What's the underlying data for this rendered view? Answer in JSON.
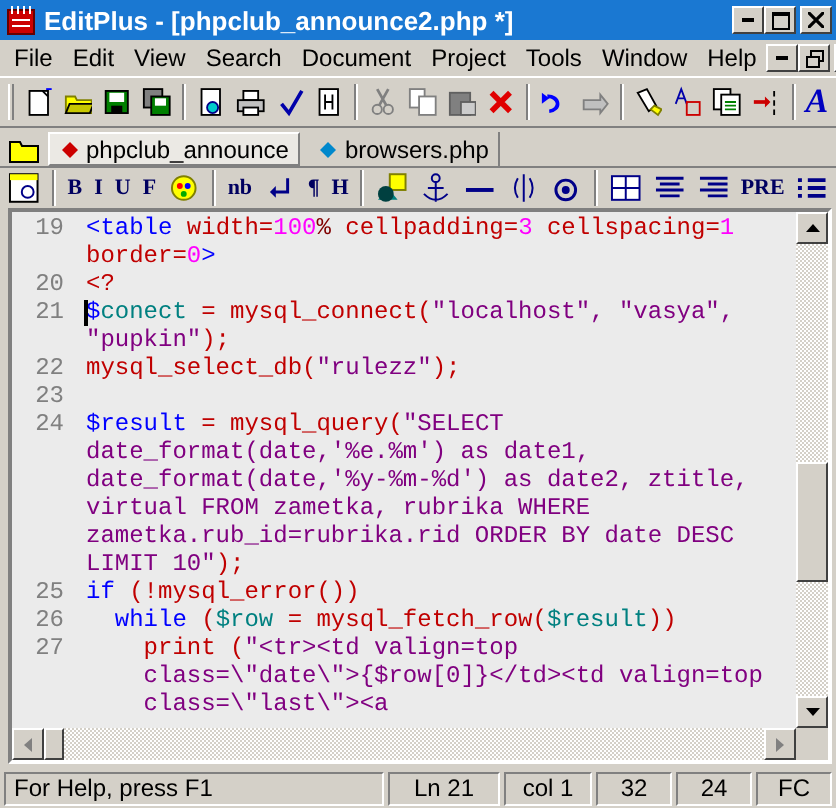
{
  "window": {
    "title": "EditPlus - [phpclub_announce2.php *]"
  },
  "menu": [
    "File",
    "Edit",
    "View",
    "Search",
    "Document",
    "Project",
    "Tools",
    "Window",
    "Help"
  ],
  "toolbar": {
    "font_button": "A"
  },
  "tabs": [
    {
      "label": "phpclub_announce",
      "selected": true
    },
    {
      "label": "browsers.php",
      "selected": false
    }
  ],
  "html_toolbar": [
    "B",
    "I",
    "U",
    "F",
    "nb",
    "¶",
    "H",
    "PRE"
  ],
  "editor": {
    "lines": [
      {
        "number": "19",
        "tokens": [
          {
            "text": "<table ",
            "color": "#0000ff"
          },
          {
            "text": "width=",
            "color": "#c00000"
          },
          {
            "text": "100",
            "color": "#ff00ff"
          },
          {
            "text": "% ",
            "color": "#800000"
          },
          {
            "text": "cellpadding=",
            "color": "#c00000"
          },
          {
            "text": "3",
            "color": "#ff00ff"
          },
          {
            "text": " cellspacing=",
            "color": "#c00000"
          },
          {
            "text": "1",
            "color": "#ff00ff"
          }
        ]
      },
      {
        "tokens": [
          {
            "text": "border=",
            "color": "#c00000"
          },
          {
            "text": "0",
            "color": "#ff00ff"
          },
          {
            "text": ">",
            "color": "#0000ff"
          }
        ]
      },
      {
        "number": "20",
        "tokens": [
          {
            "text": "<?",
            "color": "#c00000"
          }
        ]
      },
      {
        "number": "21",
        "cursor": true,
        "tokens": [
          {
            "text": "$",
            "color": "#0000ff"
          },
          {
            "text": "conect",
            "color": "#008080"
          },
          {
            "text": " = mysql_connect(",
            "color": "#c00000"
          },
          {
            "text": "\"localhost\", \"vasya\",",
            "color": "#800080"
          }
        ]
      },
      {
        "tokens": [
          {
            "text": "\"pupkin\"",
            "color": "#800080"
          },
          {
            "text": ");",
            "color": "#c00000"
          }
        ]
      },
      {
        "number": "22",
        "tokens": [
          {
            "text": "mysql_select_db(",
            "color": "#c00000"
          },
          {
            "text": "\"rulezz\"",
            "color": "#800080"
          },
          {
            "text": ");",
            "color": "#c00000"
          }
        ]
      },
      {
        "number": "23"
      },
      {
        "number": "24",
        "tokens": [
          {
            "text": "$result",
            "color": "#0000ff"
          },
          {
            "text": " = mysql_query(",
            "color": "#c00000"
          },
          {
            "text": "\"SELECT",
            "color": "#800080"
          }
        ]
      },
      {
        "tokens": [
          {
            "text": "date_format(date,'%e.%m') as date1,",
            "color": "#800080"
          }
        ]
      },
      {
        "tokens": [
          {
            "text": "date_format(date,'%y-%m-%d') as date2, ztitle,",
            "color": "#800080"
          }
        ]
      },
      {
        "tokens": [
          {
            "text": "virtual FROM zametka, rubrika WHERE",
            "color": "#800080"
          }
        ]
      },
      {
        "tokens": [
          {
            "text": "zametka.rub_id=rubrika.rid ORDER BY date DESC",
            "color": "#800080"
          }
        ]
      },
      {
        "tokens": [
          {
            "text": "LIMIT 10\"",
            "color": "#800080"
          },
          {
            "text": ");",
            "color": "#c00000"
          }
        ]
      },
      {
        "number": "25",
        "tokens": [
          {
            "text": "if ",
            "color": "#0000ff"
          },
          {
            "text": "(!mysql_error())",
            "color": "#c00000"
          }
        ]
      },
      {
        "number": "26",
        "tokens": [
          {
            "text": "  while ",
            "color": "#0000ff"
          },
          {
            "text": "(",
            "color": "#c00000"
          },
          {
            "text": "$row",
            "color": "#008080"
          },
          {
            "text": " = mysql_fetch_row(",
            "color": "#c00000"
          },
          {
            "text": "$result",
            "color": "#008080"
          },
          {
            "text": "))",
            "color": "#c00000"
          }
        ]
      },
      {
        "number": "27",
        "tokens": [
          {
            "text": "    print (",
            "color": "#c00000"
          },
          {
            "text": "\"<tr><td valign=top",
            "color": "#800080"
          }
        ]
      },
      {
        "tokens": [
          {
            "text": "    class=\\\"date\\\">{$row[0]}</td><td valign=top",
            "color": "#800080"
          }
        ]
      },
      {
        "tokens": [
          {
            "text": "    class=\\\"last\\\"><a",
            "color": "#800080"
          }
        ]
      }
    ]
  },
  "status_bar": [
    "For Help, press F1",
    "Ln 21",
    "col 1",
    "32",
    "24",
    "FC"
  ]
}
